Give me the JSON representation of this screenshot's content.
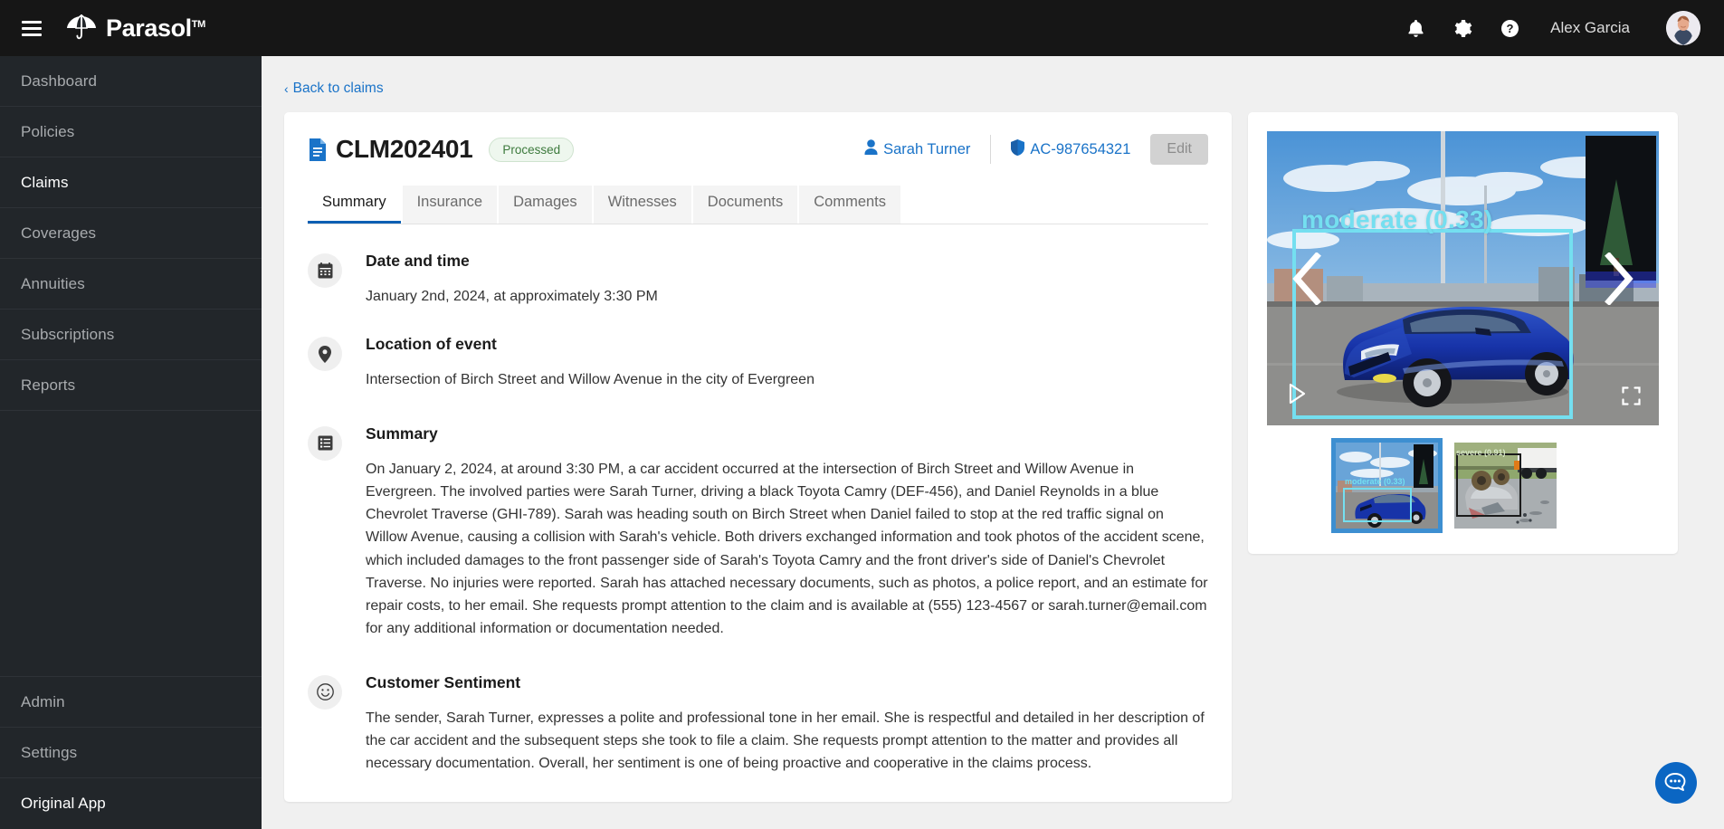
{
  "brand": {
    "name": "Parasol",
    "tm": "TM",
    "logo_icon": "umbrella-icon",
    "menu_icon": "hamburger-icon"
  },
  "topbar": {
    "notifications_icon": "bell-icon",
    "settings_icon": "gear-icon",
    "help_icon": "question-circle-icon",
    "user_name": "Alex Garcia",
    "avatar_icon": "avatar"
  },
  "sidebar": {
    "items": [
      {
        "label": "Dashboard",
        "active": false
      },
      {
        "label": "Policies",
        "active": false
      },
      {
        "label": "Claims",
        "active": true
      },
      {
        "label": "Coverages",
        "active": false
      },
      {
        "label": "Annuities",
        "active": false
      },
      {
        "label": "Subscriptions",
        "active": false
      },
      {
        "label": "Reports",
        "active": false
      }
    ],
    "bottom_items": [
      {
        "label": "Admin",
        "active": false
      },
      {
        "label": "Settings",
        "active": false
      },
      {
        "label": "Original App",
        "active": true
      }
    ]
  },
  "main": {
    "back_link": "Back to claims",
    "back_chevron": "‹"
  },
  "claim": {
    "doc_icon": "document-icon",
    "id": "CLM202401",
    "status": "Processed",
    "status_color": "#3d7a3d",
    "claimant": "Sarah Turner",
    "claimant_icon": "person-icon",
    "policy_number": "AC-987654321",
    "policy_icon": "shield-icon",
    "edit_label": "Edit",
    "tabs": [
      {
        "label": "Summary",
        "active": true
      },
      {
        "label": "Insurance",
        "active": false
      },
      {
        "label": "Damages",
        "active": false
      },
      {
        "label": "Witnesses",
        "active": false
      },
      {
        "label": "Documents",
        "active": false
      },
      {
        "label": "Comments",
        "active": false
      }
    ],
    "sections": [
      {
        "icon": "calendar-icon",
        "title": "Date and time",
        "text": "January 2nd, 2024, at approximately 3:30 PM"
      },
      {
        "icon": "map-pin-icon",
        "title": "Location of event",
        "text": "Intersection of Birch Street and Willow Avenue in the city of Evergreen"
      },
      {
        "icon": "list-icon",
        "title": "Summary",
        "text": "On January 2, 2024, at around 3:30 PM, a car accident occurred at the intersection of Birch Street and Willow Avenue in Evergreen. The involved parties were Sarah Turner, driving a black Toyota Camry (DEF-456), and Daniel Reynolds in a blue Chevrolet Traverse (GHI-789). Sarah was heading south on Birch Street when Daniel failed to stop at the red traffic signal on Willow Avenue, causing a collision with Sarah's vehicle. Both drivers exchanged information and took photos of the accident scene, which included damages to the front passenger side of Sarah's Toyota Camry and the front driver's side of Daniel's Chevrolet Traverse. No injuries were reported. Sarah has attached necessary documents, such as photos, a police report, and an estimate for repair costs, to her email. She requests prompt attention to the claim and is available at (555) 123-4567 or sarah.turner@email.com for any additional information or documentation needed."
      },
      {
        "icon": "smiley-icon",
        "title": "Customer Sentiment",
        "text": "The sender, Sarah Turner, expresses a polite and professional tone in her email. She is respectful and detailed in her description of the car accident and the subsequent steps she took to file a claim. She requests prompt attention to the matter and provides all necessary documentation. Overall, her sentiment is one of being proactive and cooperative in the claims process."
      }
    ]
  },
  "media": {
    "prev_icon": "chevron-left-icon",
    "next_icon": "chevron-right-icon",
    "play_icon": "play-icon",
    "fullscreen_icon": "fullscreen-icon",
    "detection_label": "moderate (0.33)",
    "detection_color": "#74dff0",
    "thumbnails": [
      {
        "label": "moderate (0.33)",
        "selected": true
      },
      {
        "label": "severe (0.91)",
        "selected": false
      }
    ]
  },
  "chat": {
    "icon": "chat-bubble-icon",
    "color": "#0b66c3"
  }
}
